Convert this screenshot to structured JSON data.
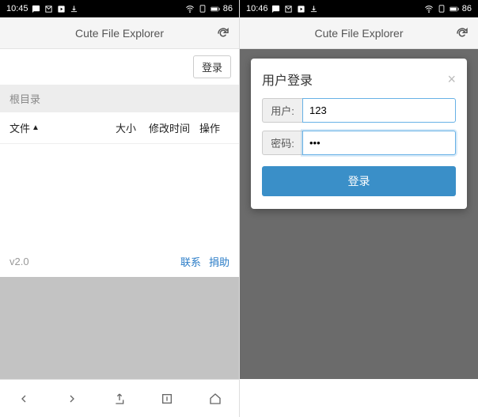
{
  "left": {
    "status": {
      "time": "10:45",
      "battery": "86"
    },
    "app_title": "Cute File Explorer",
    "login_button": "登录",
    "breadcrumb": "根目录",
    "columns": {
      "file": "文件",
      "size": "大小",
      "time": "修改时间",
      "action": "操作"
    },
    "version": "v2.0",
    "links": {
      "contact": "联系",
      "donate": "捐助"
    }
  },
  "right": {
    "status": {
      "time": "10:46",
      "battery": "86"
    },
    "app_title": "Cute File Explorer",
    "modal": {
      "title": "用户登录",
      "user_label": "用户:",
      "user_value": "123",
      "pass_label": "密码:",
      "pass_value": "•••",
      "submit": "登录"
    }
  }
}
